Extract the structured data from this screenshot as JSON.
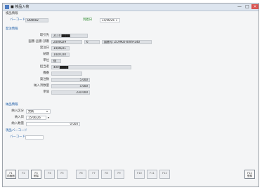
{
  "window": {
    "title": "■ 検品入荷",
    "buttons": [
      "—",
      "□",
      "×"
    ]
  },
  "search": {
    "section": "検品情報",
    "barcode_label": "バーコード",
    "barcode_value": "D00002",
    "arrival_date_label": "到着日",
    "arrival_date_value": "15/06/26"
  },
  "order": {
    "section": "発注情報",
    "rows": [
      {
        "label": "取引先",
        "value": "2110  ████"
      },
      {
        "label": "図番-品番-部番",
        "value": "Z000029",
        "extra1": "6",
        "extra2": "図番号: ZC9902-0049-240"
      },
      {
        "label": "発注日",
        "value": "14/06/21"
      },
      {
        "label": "納期",
        "value": "14/07/20"
      },
      {
        "label": "単位",
        "value": "個"
      },
      {
        "label": "担当者",
        "value": "400  ████"
      },
      {
        "label": "機番",
        "value": ""
      },
      {
        "label": "発注数",
        "value": "5.000"
      },
      {
        "label": "納入済数量",
        "value": "5.000"
      },
      {
        "label": "単価",
        "value": "230.000"
      }
    ]
  },
  "receive": {
    "section": "納品情報",
    "category_label": "納入区分",
    "category_value": "完納",
    "date_label": "納入日",
    "date_value": "15/06/26",
    "qty_label": "納入数量",
    "qty_value": "0.000"
  },
  "scan": {
    "section": "現品バーコード",
    "barcode_label": "バーコード",
    "barcode_value": ""
  },
  "fkeys": [
    {
      "label": "F1\n前画面",
      "active": true
    },
    {
      "label": "F2",
      "active": false
    },
    {
      "label": "F3\n削除",
      "active": true
    },
    {
      "label": "F4",
      "active": false
    },
    {
      "label": "F5",
      "active": false
    },
    {
      "label": "F6",
      "active": false
    },
    {
      "label": "F7",
      "active": false
    },
    {
      "label": "F8",
      "active": false
    },
    {
      "label": "F9",
      "active": false
    },
    {
      "label": "F10",
      "active": false
    },
    {
      "label": "F11",
      "active": false
    },
    {
      "label": "F12",
      "active": false
    },
    {
      "label": "F12\n登録",
      "active": true
    }
  ]
}
